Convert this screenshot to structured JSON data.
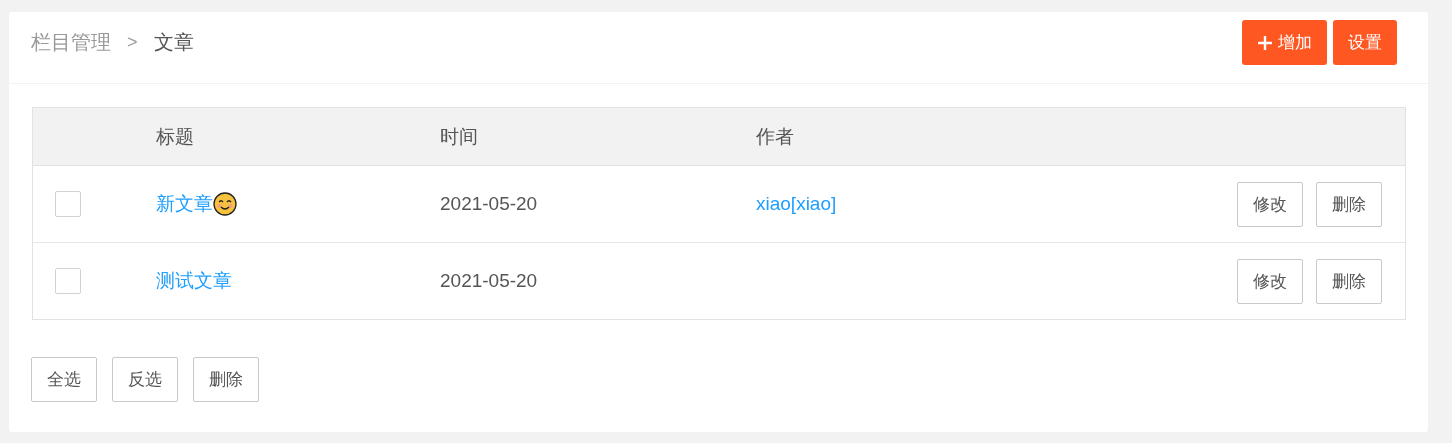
{
  "breadcrumb": [
    {
      "label": "栏目管理",
      "selected": false
    },
    {
      "label": "文章",
      "selected": true
    }
  ],
  "breadcrumb_separator": ">",
  "header_buttons": [
    {
      "label": "增加",
      "kind": "add"
    },
    {
      "label": "设置",
      "kind": "plain"
    }
  ],
  "table": {
    "columns": [
      "标题",
      "时间",
      "作者"
    ],
    "rows": [
      {
        "checked": false,
        "title": "新文章",
        "title_emoji": true,
        "time": "2021-05-20",
        "author": "xiao[xiao]",
        "actions": [
          "修改",
          "删除"
        ]
      },
      {
        "checked": false,
        "title": "测试文章",
        "title_emoji": false,
        "time": "2021-05-20",
        "actions": [
          "修改",
          "删除"
        ]
      }
    ]
  },
  "footer_buttons": [
    "全选",
    "反选",
    "删除"
  ]
}
